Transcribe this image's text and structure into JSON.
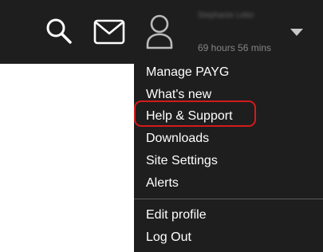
{
  "header": {
    "icons": [
      "search-icon",
      "mail-icon",
      "user-icon",
      "caret-down-icon"
    ],
    "user": {
      "name": "Stephanie Leborte",
      "time_remaining": "69 hours 56 mins"
    }
  },
  "menu": {
    "items": [
      {
        "label": "Manage PAYG"
      },
      {
        "label": "What's new"
      },
      {
        "label": "Help & Support"
      },
      {
        "label": "Downloads"
      },
      {
        "label": "Site Settings"
      },
      {
        "label": "Alerts"
      }
    ],
    "account_items": [
      {
        "label": "Edit profile"
      },
      {
        "label": "Log Out"
      }
    ]
  },
  "colors": {
    "bar_background": "#1e1e1e",
    "menu_text": "#ffffff",
    "muted_text": "#858585",
    "highlight": "#d41a1a"
  }
}
